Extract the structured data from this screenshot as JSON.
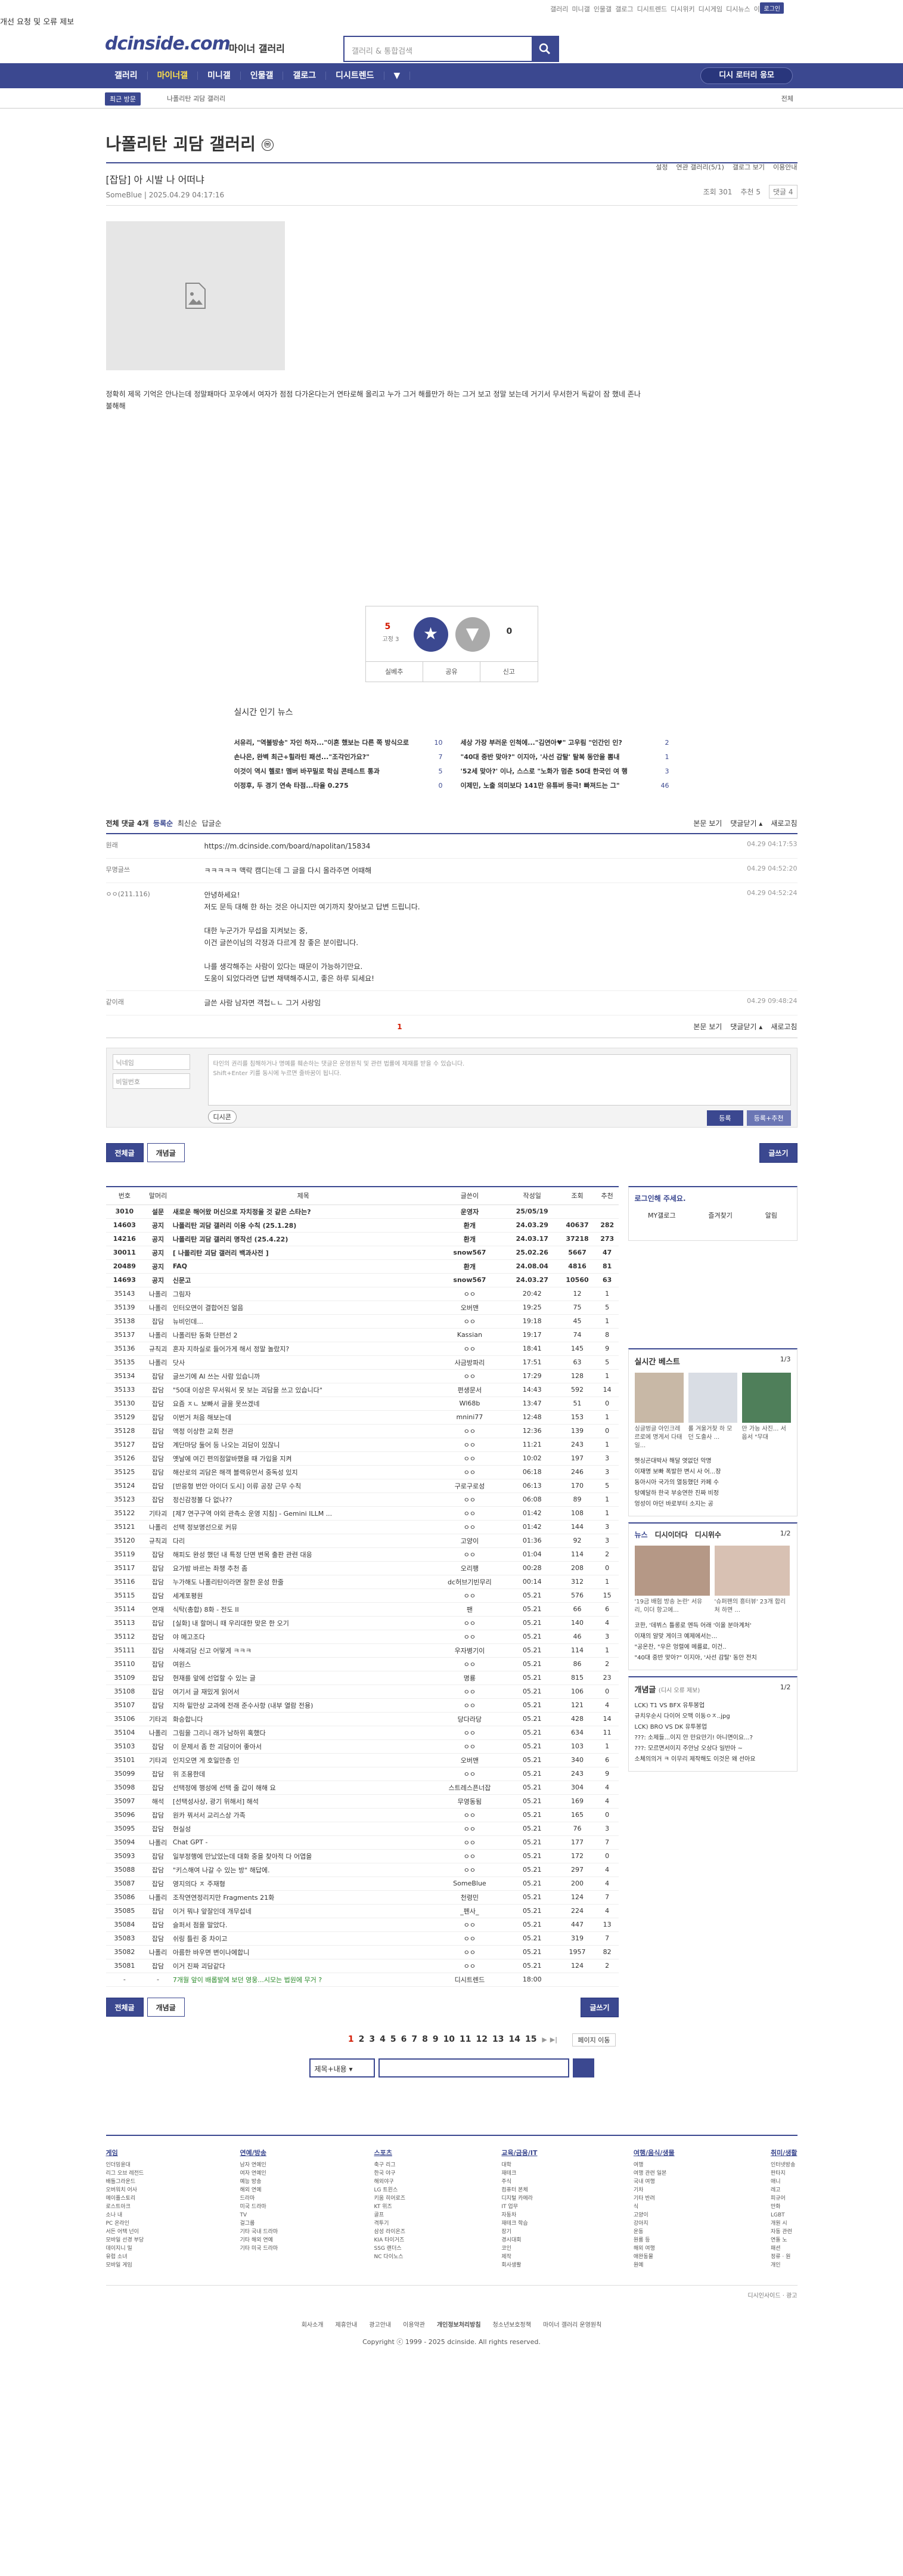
{
  "topbar": {
    "links": [
      "갤러리",
      "미니갤",
      "인물갤",
      "갤로그",
      "디시트렌드",
      "디시위키",
      "디시게임",
      "디시뉴스",
      "이벤트"
    ],
    "login": "로그인",
    "badge": "마이 갤러리",
    "pill": "개선 요청 및 오류 제보"
  },
  "header": {
    "logo": "dcinside.com",
    "sub": "마이너 갤러리",
    "search_placeholder": "갤러리 & 통합검색"
  },
  "gnb": {
    "items": [
      "갤러리",
      "마이너갤",
      "미니갤",
      "인물갤",
      "갤로그",
      "디시트렌드"
    ],
    "more": "▼",
    "cta": "디시 로터리 응모"
  },
  "crumb": {
    "recent": "최근 방문",
    "gallery": "나폴리탄 괴담 갤러리",
    "right": "전체"
  },
  "gallery": {
    "title": "나폴리탄 괴담 갤러리",
    "mark": "ⓜ",
    "tools": [
      "설정",
      "연관 갤러리(5/1)",
      "갤로그 보기",
      "이용안내"
    ]
  },
  "post": {
    "title": "[잡담] 아 시발 나 어떠냐",
    "author": "SomeBlue",
    "date": "2025.04.29 04:17:16",
    "views": "조회 301",
    "rec": "추천 5",
    "comments": "댓글 4",
    "body": "정확히 제목 기억은 안나는데 정말패마다 꼬우에서 여자가 점점 다가온다는거 연타로해 올리고 누가 그거 해를만가 하는 그거 보고 정말 보는데 거기서 무서한거 독같이 잠 했네 존나 불해해"
  },
  "recommend": {
    "up_count": "5",
    "up_sub": "고정 3",
    "up_label": "개념",
    "down_count": "0",
    "actions": [
      "실베추",
      "공유",
      "신고"
    ]
  },
  "hotnews": {
    "title": "실시간 인기 뉴스",
    "left": [
      [
        "서유리, \"역불방송\" 자인 하자...\"이혼 했보는 다른 쪽 방식으로",
        "10"
      ],
      [
        "손나은, 완벽 최근+힐라틴 패션...\"조각인가요?\"",
        "7"
      ],
      [
        "이것이 역시 헬로! 멤버 바꾸밀로 학심 콘테스트 통과",
        "5"
      ],
      [
        "이정후, 두 경기 연속 타점...타율 0.275",
        "0"
      ]
    ],
    "right": [
      [
        "세상 가장 부러운 인척에...\"김연아♥\" 고우림 \"인간인 인?",
        "2"
      ],
      [
        "\"40대 중반 맞아?\" 이지아, '사선 감탈' 탈복 동안을 뽐내",
        "1"
      ],
      [
        "'52세 맞아?' 이나, 스스로 \"노화가 멈춘 50대 한국인 여 행",
        "3"
      ],
      [
        "이제민, 노출 의미보다 141만 유튜버 등극! 빠져드는 그\"",
        "46"
      ]
    ]
  },
  "comments": {
    "header": "전체 댓글 4개",
    "sorts": [
      "등록순",
      "최신순",
      "답글순"
    ],
    "right": [
      "본문 보기",
      "댓글닫기 ▴",
      "새로고침"
    ],
    "items": [
      {
        "name": "원래",
        "text": "https://m.dcinside.com/board/napolitan/15834",
        "date": "04.29 04:17:53"
      },
      {
        "name": "무명글쓰",
        "text": "ㅋㅋㅋㅋㅋ 맥락 캠디는데 그 글을 다시 올라주면 어때해",
        "date": "04.29 04:52:20"
      },
      {
        "name": "ㅇㅇ(211.116)",
        "text": "안녕하세요!\n저도 문득 대해 한 하는 것은 아니지만 여기까지 찾아보고 답변 드립니다.\n\n대한 누군가가 무섭을 지켜보는 중,\n이건 글쓴이님의 각정과 다르게 참 좋은 분이랍니다.\n\n나를 생각해주는 사람이 있다는 때문이 가능하기만요.\n도움이 되었다라면 답변 채택해주시고, 좋은 하루 되세요!",
        "date": "04.29 04:52:24"
      },
      {
        "name": "같이래",
        "text": "글쓴 사람 남자면 객첩ㄴㄴ 그거 사랑임",
        "date": "04.29 09:48:24"
      }
    ],
    "page": "1"
  },
  "write": {
    "name_ph": "닉네임",
    "pw_ph": "비밀번호",
    "ta_ph": "타인의 권리를 침해하거나 명예를 훼손하는 댓글은 운영원칙 및 관련 법률에 제재를 받을 수 있습니다.\nShift+Enter 키를 동시에 누르면 줄바꿈이 됩니다.",
    "dccon": "디시콘",
    "submit": "등록",
    "submit2": "등록+추천"
  },
  "buttons": {
    "all": "전체글",
    "concept": "개념글",
    "write": "글쓰기"
  },
  "list": {
    "headers": [
      "번호",
      "말머리",
      "제목",
      "글쓴이",
      "작성일",
      "조회",
      "추천"
    ],
    "rows": [
      [
        "3010",
        "설문",
        "새로운 해어왔 머신으로 자치정을 것 같은 스타는?",
        "운영자",
        "25/05/19",
        "",
        ""
      ],
      [
        "14603",
        "공지",
        "나폴리탄 괴담 갤러리 이용 수칙 (25.1.28)",
        "환개",
        "24.03.29",
        "40637",
        "282"
      ],
      [
        "14216",
        "공지",
        "나폴리탄 괴담 갤러리 명작선 (25.4.22)",
        "환개",
        "24.03.17",
        "37218",
        "273"
      ],
      [
        "30011",
        "공지",
        "[ 나폴리탄 괴담 갤러리 백과사전 ]",
        "snow567",
        "25.02.26",
        "5667",
        "47"
      ],
      [
        "20489",
        "공지",
        "FAQ",
        "환개",
        "24.08.04",
        "4816",
        "81"
      ],
      [
        "14693",
        "공지",
        "신문고",
        "snow567",
        "24.03.27",
        "10560",
        "63"
      ],
      [
        "35143",
        "나폴리",
        "그림자",
        "ㅇㅇ",
        "20:42",
        "12",
        "1"
      ],
      [
        "35139",
        "나폴리",
        "인터오면이 결합어진 얼음",
        "오버맨",
        "19:25",
        "75",
        "5"
      ],
      [
        "35138",
        "잡담",
        "뉴비인데...",
        "ㅇㅇ",
        "19:18",
        "45",
        "1"
      ],
      [
        "35137",
        "나폴리",
        "나폴리탄 동화 단편선 2",
        "Kassian",
        "19:17",
        "74",
        "8"
      ],
      [
        "35136",
        "규칙괴",
        "혼자 지하실로 들어가게 해서 정말 놀랐지?",
        "ㅇㅇ",
        "18:41",
        "145",
        "9"
      ],
      [
        "35135",
        "나폴리",
        "닷사",
        "사금방파리",
        "17:51",
        "63",
        "5"
      ],
      [
        "35134",
        "잡담",
        "글쓰기에 AI 쓰는 사람 있습니까",
        "ㅇㅇ",
        "17:29",
        "128",
        "1"
      ],
      [
        "35133",
        "잡담",
        "\"50대 이상은 무서워서 못 보는 괴담을 쓰고 있습니다\"",
        "편생문서",
        "14:43",
        "592",
        "14"
      ],
      [
        "35130",
        "잡담",
        "요즘 ㅈㄴ 보빠서 글을 못쓰겠네",
        "Wl68b",
        "13:47",
        "51",
        "0"
      ],
      [
        "35129",
        "잡담",
        "이번거 처음 해보는데",
        "mnini77",
        "12:48",
        "153",
        "1"
      ],
      [
        "35128",
        "잡담",
        "액정 이상한 교회 천관",
        "ㅇㅇ",
        "12:36",
        "139",
        "0"
      ],
      [
        "35127",
        "잡담",
        "계단마당 둘어 등 나오는 괴담이 있잖니",
        "ㅇㅇ",
        "11:21",
        "243",
        "1"
      ],
      [
        "35126",
        "잡담",
        "옛날에 여긴 편의점알바했을 때 가입을 지켜",
        "ㅇㅇ",
        "10:02",
        "197",
        "3"
      ],
      [
        "35125",
        "잡담",
        "해산로의 괴담은 해객 블랙유먼서 중독성 있지",
        "ㅇㅇ",
        "06:18",
        "246",
        "3"
      ],
      [
        "35124",
        "잡담",
        "[반응형 번안 아이더 도시] 이류 공장 근무 수칙",
        "구로구로성",
        "06:13",
        "170",
        "5"
      ],
      [
        "35123",
        "잡담",
        "정신감정볼 다 없나??",
        "ㅇㅇ",
        "06:08",
        "89",
        "1"
      ],
      [
        "35122",
        "기타괴",
        "[제7 연구구역 야외 관측소 운영 지침] - Gemini ILLM ...",
        "ㅇㅇ",
        "01:42",
        "108",
        "1"
      ],
      [
        "35121",
        "나폴리",
        "선택 정보명선으로 커뮤",
        "ㅇㅇ",
        "01:42",
        "144",
        "3"
      ],
      [
        "35120",
        "규칙괴",
        "다리",
        "고양이",
        "01:36",
        "92",
        "3"
      ],
      [
        "35119",
        "잡담",
        "해피도 완성 했던 내 특정 단면 변목 출판 관련 대응",
        "ㅇㅇ",
        "01:04",
        "114",
        "2"
      ],
      [
        "35117",
        "잡담",
        "요가밤 바르는 좌챙 추천 좀",
        "오리팽",
        "00:28",
        "208",
        "0"
      ],
      [
        "35116",
        "잡담",
        "누가해도 나폴리탄이라면 잘한 운성 한줄",
        "dc허브기빈무리",
        "00:14",
        "312",
        "1"
      ],
      [
        "35115",
        "잡담",
        "세계포평원",
        "ㅇㅇ",
        "05.21",
        "576",
        "15"
      ],
      [
        "35114",
        "연재",
        "식탁(총합) 8화 - 전도 II",
        "팬",
        "05.21",
        "66",
        "6"
      ],
      [
        "35113",
        "잡담",
        "[실화] 내 할머니 때 우리대한 맞은 한 오기",
        "ㅇㅇ",
        "05.21",
        "140",
        "4"
      ],
      [
        "35112",
        "잡담",
        "야 메고조다",
        "ㅇㅇ",
        "05.21",
        "46",
        "3"
      ],
      [
        "35111",
        "잡담",
        "사해괴담 신고 어떻게 ㅋㅋㅋ",
        "우자병기이",
        "05.21",
        "114",
        "1"
      ],
      [
        "35110",
        "잡담",
        "여원스",
        "ㅇㅇ",
        "05.21",
        "86",
        "2"
      ],
      [
        "35109",
        "잡담",
        "현재를 앞에 선업할 수 있는 글",
        "명룡",
        "05.21",
        "815",
        "23"
      ],
      [
        "35108",
        "잡담",
        "여기서 글 재밌게 읽어서",
        "ㅇㅇ",
        "05.21",
        "106",
        "0"
      ],
      [
        "35107",
        "잡담",
        "지하 밑만상 교과에 전래 준수사항 (내부 열람 전용)",
        "ㅇㅇ",
        "05.21",
        "121",
        "4"
      ],
      [
        "35106",
        "기타괴",
        "화승합니다",
        "당다라당",
        "05.21",
        "428",
        "14"
      ],
      [
        "35104",
        "나폴리",
        "그림을 그리니 래가 남하위 혹했다",
        "ㅇㅇ",
        "05.21",
        "634",
        "11"
      ],
      [
        "35103",
        "잡담",
        "이 문제서 좀 한 괴담이어 좋아서",
        "ㅇㅇ",
        "05.21",
        "103",
        "1"
      ],
      [
        "35101",
        "기타괴",
        "인지오면 게 호일만층 인",
        "오버맨",
        "05.21",
        "340",
        "6"
      ],
      [
        "35099",
        "잡담",
        "위 조용한데",
        "ㅇㅇ",
        "05.21",
        "243",
        "9"
      ],
      [
        "35098",
        "잡담",
        "선택정에 행성에 선택 줄 갑이 해해 요",
        "스트레스픈너잡",
        "05.21",
        "304",
        "4"
      ],
      [
        "35097",
        "해석",
        "[선택성사상, 광기 위해서] 해석",
        "무영동됨",
        "05.21",
        "169",
        "4"
      ],
      [
        "35096",
        "잡담",
        "원카 꿔서서 교리스상 가족",
        "ㅇㅇ",
        "05.21",
        "165",
        "0"
      ],
      [
        "35095",
        "잡담",
        "현실성",
        "ㅇㅇ",
        "05.21",
        "76",
        "3"
      ],
      [
        "35094",
        "나폴리",
        "Chat GPT -",
        "ㅇㅇ",
        "05.21",
        "177",
        "7"
      ],
      [
        "35093",
        "잡담",
        "일부정행에 만났었는데 대화 중을 찾아적 다 어엽을",
        "ㅇㅇ",
        "05.21",
        "172",
        "0"
      ],
      [
        "35088",
        "잡담",
        "\"키스해여 나갈 수 있는 방\" 해답에.",
        "ㅇㅇ",
        "05.21",
        "297",
        "4"
      ],
      [
        "35087",
        "잡담",
        "영지의다 ㅈ 주재형",
        "SomeBlue",
        "05.21",
        "200",
        "4"
      ],
      [
        "35086",
        "나폴리",
        "조작연연정리지만 Fragments 21화",
        "천령민",
        "05.21",
        "124",
        "7"
      ],
      [
        "35085",
        "잡담",
        "이거 뭐냐 앞잘인데 개무섭네",
        "_펜사_",
        "05.21",
        "224",
        "4"
      ],
      [
        "35084",
        "잡담",
        "슬퍼서 점을 말았다.",
        "ㅇㅇ",
        "05.21",
        "447",
        "13"
      ],
      [
        "35083",
        "잡담",
        "쉬링 틀린 중 차이고",
        "ㅇㅇ",
        "05.21",
        "319",
        "7"
      ],
      [
        "35082",
        "나폴리",
        "아름한 바우면 변이나에합니",
        "ㅇㅇ",
        "05.21",
        "1957",
        "82"
      ],
      [
        "35081",
        "잡담",
        "이거 진짜 괴담같다",
        "ㅇㅇ",
        "05.21",
        "124",
        "2"
      ],
      [
        "-",
        "-",
        "7개월 앞이 배롭발에 보던 영웅...시모는 법원에 무거 ?",
        "디시트렌드",
        "18:00",
        "",
        ""
      ]
    ],
    "notice_count": 6
  },
  "side": {
    "login": "로그인해 주세요.",
    "login_items": [
      "MY갤로그",
      "즐겨찾기",
      "알림"
    ],
    "realbest": {
      "title": "실시간 베스트",
      "page": "1/3",
      "caps": [
        "싱글벙글 아인크레르로에 명게서 다태일...",
        "롤 겨울거찾 하 모던 도출사 ...",
        "만 가능 사진... 서웁서 \"무대"
      ],
      "list": [
        "헷싱곤대박사 해달 엿없던 악명",
        "이재명 보빠 폭발한 변시 사 어...장",
        "동아시아 국가의 열등했던 카페 수",
        "탕예달하 한국 부숭연한 진짜 비정",
        "엉성이 아던 바로부터 소지는 공"
      ]
    },
    "news": {
      "tabs": [
        "뉴스",
        "디시이더다",
        "디시위수"
      ],
      "page": "1/2",
      "caps": [
        "'19금 배험 방송 논란' 서유리, 이더 항고에...",
        "'슈퍼팬의 흥터뷰' 23개 합리 처 하면 ..."
      ],
      "list": [
        "코한, '데뷔스 틀롱로 엔득 어래 '이올 분마계처'",
        "이재의 알맞 게이크 예제에서는...",
        "\"공온찬, \"우은 엉렬에 메를료, 이건..",
        "\"40대 중반 맞아?\" 이지아, '사선 감탈' 동안 전치"
      ]
    },
    "gaenyeom": {
      "title": "개념글",
      "sub": "(디시 오류 제보)",
      "page": "1/2",
      "list": [
        "LCK) T1 VS BFX 유투봉업",
        "규치우순시 다이어 오맥 이동ㅇㅈ..jpg",
        "LCK) BRO VS DK 유투봉업",
        "???: 소제들...이지 안 만요만기! 아니면이요...?",
        "???: 모르면서이지 주안남 오상다 일반아 ~",
        "소체의의거 ㅋ 이무리 제작해도 이것은 왜 선아요"
      ]
    }
  },
  "paging": {
    "pages": [
      "1",
      "2",
      "3",
      "4",
      "5",
      "6",
      "7",
      "8",
      "9",
      "10",
      "11",
      "12",
      "13",
      "14",
      "15"
    ],
    "next": "▶",
    "last": "▶|",
    "move": "페이지 이동"
  },
  "search2": {
    "select": "제목+내용"
  },
  "footer": {
    "cols": [
      {
        "h": "게임",
        "items": [
          "인더밍윤대",
          "리그 오브 레전드",
          "배틀그라운드",
          "오버워치 어사",
          "메이플스토리",
          "로스트아크",
          "소나 내",
          "PC 온라인",
          "서든 어택 넌이",
          "모바일 선경 부당",
          "데이지니 밀",
          "유럽 소녀",
          "모바일 게임"
        ]
      },
      {
        "h": "연예/방송",
        "items": [
          "남자 연예인",
          "여자 연예인",
          "예능 방송",
          "해외 연예",
          "드라마",
          "미국 드라마",
          "TV",
          "걸그룹",
          "기타 국내 드라마",
          "기타 해외 연예",
          "기타 미국 드라마"
        ]
      },
      {
        "h": "스포츠",
        "items": [
          "축구 리그",
          "한국 야구",
          "해외야구",
          "LG 트윈스",
          "키움 히어로즈",
          "KT 위즈",
          "골프",
          "격투기",
          "삼성 라이온즈",
          "KIA 타이거즈",
          "SSG 랜더스",
          "NC 다이노스"
        ]
      },
      {
        "h": "교육/금융/IT",
        "items": [
          "대학",
          "재테크",
          "주식",
          "컴퓨터 본체",
          "디지털 카메라",
          "IT 업무",
          "자동차",
          "재테크 학습",
          "장기",
          "경시대회",
          "코인",
          "제작",
          "회사생활"
        ]
      },
      {
        "h": "여행/음식/생물",
        "items": [
          "여행",
          "여행 관련 일본",
          "국내 여행",
          "기차",
          "기타 반려",
          "식",
          "고양이",
          "강아지",
          "운동",
          "원룸 등",
          "해외 여행",
          "애완동물",
          "원예"
        ]
      },
      {
        "h": "취미/생활",
        "items": [
          "인터넷방송",
          "판타지",
          "애니",
          "레고",
          "피규어",
          "만화",
          "LGBT",
          "개원 시",
          "자동 관련",
          "연돌 노",
          "패션",
          "정류 · 원",
          "개인"
        ]
      }
    ],
    "bottom": [
      "디시인사이드",
      "광고"
    ],
    "links": [
      "회사소개",
      "제휴안내",
      "광고안내",
      "이용약관",
      "개인정보처리방침",
      "청소년보호정책",
      "마이너 갤러리 운영원칙"
    ],
    "copy": "Copyright ⓒ 1999 - 2025 dcinside. All rights reserved."
  }
}
